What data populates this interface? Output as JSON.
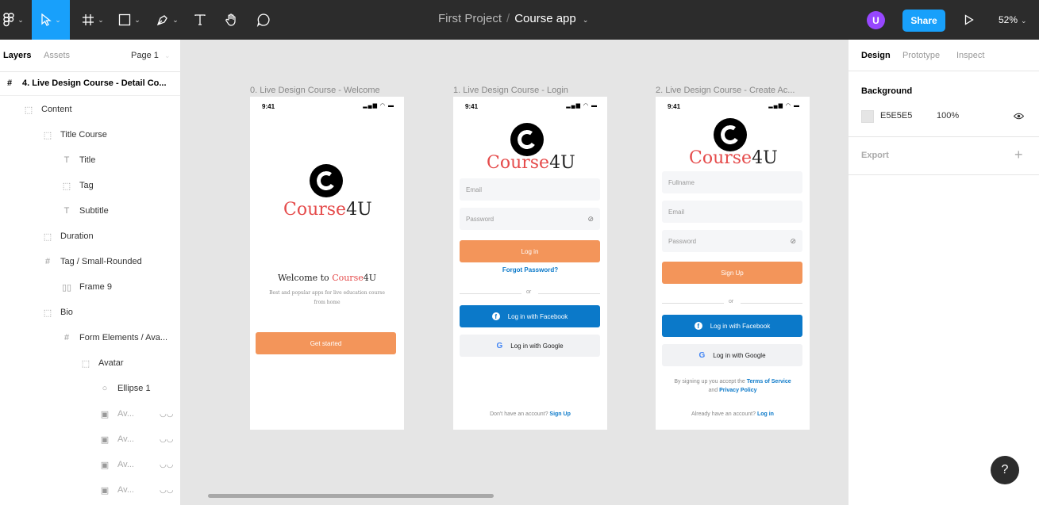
{
  "toolbar": {
    "project": "First Project",
    "separator": "/",
    "file": "Course app",
    "share_label": "Share",
    "zoom": "52%",
    "user_initial": "U"
  },
  "left_panel": {
    "tab_layers": "Layers",
    "tab_assets": "Assets",
    "page": "Page 1",
    "layers": [
      {
        "label": "4. Live Design Course - Detail Co...",
        "icon": "#"
      },
      {
        "label": "Content",
        "icon": "⬚"
      },
      {
        "label": "Title Course",
        "icon": "⬚"
      },
      {
        "label": "Title",
        "icon": "T"
      },
      {
        "label": "Tag",
        "icon": "⬚"
      },
      {
        "label": "Subtitle",
        "icon": "T"
      },
      {
        "label": "Duration",
        "icon": "⬚"
      },
      {
        "label": "Tag / Small-Rounded",
        "icon": "#"
      },
      {
        "label": "Frame 9",
        "icon": "▯▯"
      },
      {
        "label": "Bio",
        "icon": "⬚"
      },
      {
        "label": "Form Elements / Ava...",
        "icon": "#"
      },
      {
        "label": "Avatar",
        "icon": "⬚"
      },
      {
        "label": "Ellipse 1",
        "icon": "○"
      },
      {
        "label": "Av...",
        "icon": "▣"
      },
      {
        "label": "Av...",
        "icon": "▣"
      },
      {
        "label": "Av...",
        "icon": "▣"
      },
      {
        "label": "Av...",
        "icon": "▣"
      }
    ]
  },
  "right_panel": {
    "tab_design": "Design",
    "tab_prototype": "Prototype",
    "tab_inspect": "Inspect",
    "background_label": "Background",
    "background_hex": "E5E5E5",
    "background_opacity": "100%",
    "export_label": "Export",
    "background_color": "#e5e5e5"
  },
  "help_label": "?",
  "frames": {
    "welcome": {
      "title": "0. Live Design Course - Welcome",
      "time": "9:41",
      "brand_a": "Course",
      "brand_b": "4U",
      "welcome_a": "Welcome to ",
      "welcome_b": "Course",
      "welcome_c": "4U",
      "tagline_1": "Best and popular apps for live education course",
      "tagline_2": "from home",
      "button": "Get started"
    },
    "login": {
      "title": "1. Live Design Course - Login",
      "time": "9:41",
      "brand_a": "Course",
      "brand_b": "4U",
      "email": "Email",
      "password": "Password",
      "button": "Log in",
      "forgot": "Forgot Password?",
      "or": "or",
      "facebook": "Log in with Facebook",
      "google": "Log in with Google",
      "footer_a": "Don't have an account? ",
      "footer_b": "Sign Up"
    },
    "signup": {
      "title": "2. Live Design Course - Create Ac...",
      "time": "9:41",
      "brand_a": "Course",
      "brand_b": "4U",
      "fullname": "Fullname",
      "email": "Email",
      "password": "Password",
      "button": "Sign Up",
      "or": "or",
      "facebook": "Log in with Facebook",
      "google": "Log in with Google",
      "terms_a": "By signing up you accept the ",
      "terms_b": "Terms of Service",
      "terms_c": "and ",
      "terms_d": "Privacy Policy",
      "footer_a": "Already have an account? ",
      "footer_b": "Log in"
    }
  }
}
